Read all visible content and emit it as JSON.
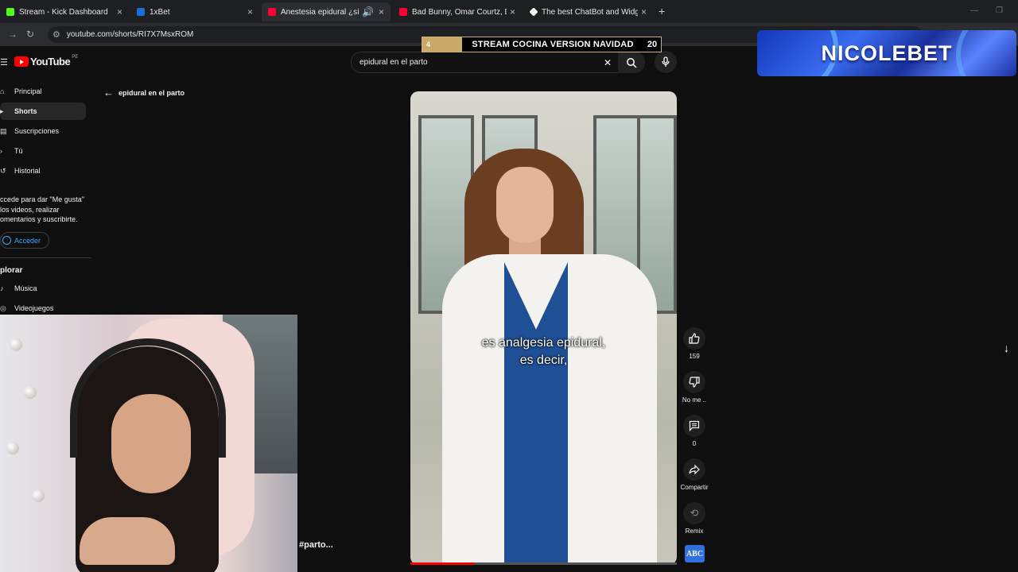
{
  "browser": {
    "tabs": [
      {
        "title": "Stream - Kick Dashboard",
        "favicon_color": "#53fc18",
        "active": false
      },
      {
        "title": "1xBet",
        "favicon_color": "#1a6fd6",
        "active": false
      },
      {
        "title": "Anestesia epidural ¿sí o no?",
        "favicon_color": "#ff0033",
        "active": true
      },
      {
        "title": "Bad Bunny, Omar Courtz, Dei V",
        "favicon_color": "#ff0033",
        "active": false
      },
      {
        "title": "The best ChatBot and Widgets",
        "favicon_color": "#ffffff",
        "active": false
      }
    ],
    "url": "youtube.com/shorts/RI7X7MsxROM"
  },
  "overlay": {
    "left_number": "4",
    "title": "STREAM COCINA VERSION NAVIDAD",
    "right_number": "20"
  },
  "banner": {
    "text": "NICOLEBET"
  },
  "youtube": {
    "logo_text": "YouTube",
    "region": "PE",
    "search": {
      "query": "epidural en el parto"
    },
    "back_label": "epidural en el parto",
    "sidebar": {
      "items": [
        {
          "label": "Principal"
        },
        {
          "label": "Shorts"
        },
        {
          "label": "Suscripciones"
        },
        {
          "label": "Tú"
        },
        {
          "label": "Historial"
        }
      ],
      "signin_text": "ccede para dar \"Me gusta\" los videos, realizar omentarios y suscribirte.",
      "signin_button": "Acceder",
      "explore_title": "plorar",
      "explore_items": [
        {
          "label": "Música"
        },
        {
          "label": "Videojuegos"
        }
      ]
    },
    "video": {
      "caption_line1": "es analgesia epidural,",
      "caption_line2": "es decir,",
      "hashtag": "#parto...",
      "progress": 0.24
    },
    "actions": {
      "likes": "159",
      "dislike": "No me ..",
      "comments": "0",
      "share": "Compartir",
      "remix": "Remix",
      "channel_avatar": "ABC"
    }
  }
}
